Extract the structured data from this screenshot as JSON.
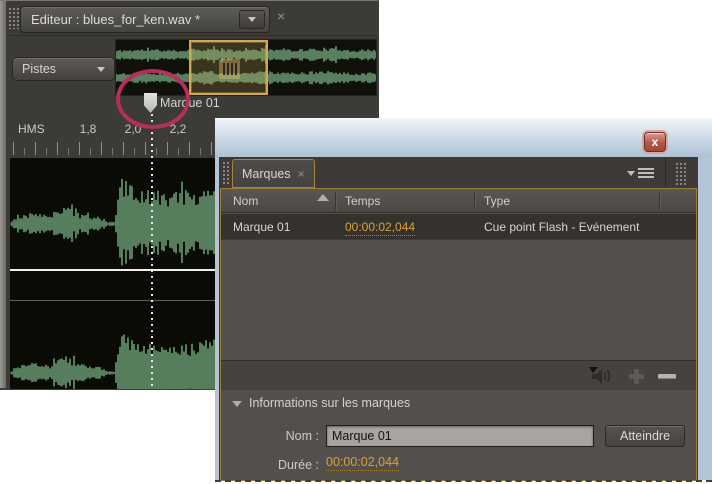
{
  "editor": {
    "tab_title": "Editeur : blues_for_ken.wav *",
    "tab_close": "×",
    "tracks_button_label": "Pistes",
    "marker_label": "Marque 01",
    "ruler_unit": "HMS",
    "tick_labels": [
      "1,8",
      "2,0",
      "2,2"
    ]
  },
  "marker_panel": {
    "window_close_label": "x",
    "tab_label": "Marques",
    "tab_close": "×",
    "columns": [
      "Nom",
      "Temps",
      "Type"
    ],
    "rows": [
      {
        "name": "Marque 01",
        "time": "00:00:02,044",
        "type": "Cue point Flash - Evénement"
      }
    ],
    "info": {
      "title": "Informations sur les marques",
      "name_label": "Nom :",
      "name_value": "Marque 01",
      "goto_button_label": "Atteindre",
      "duration_label": "Durée :",
      "duration_value": "00:00:02,044"
    }
  },
  "colors": {
    "panel_focus_orange": "#a5853e",
    "time_link_orange": "#d8a13c",
    "waveform_green": "#7fbd8c",
    "annotation_pink": "#b62e5c",
    "selection_gold": "#cfa94e"
  }
}
